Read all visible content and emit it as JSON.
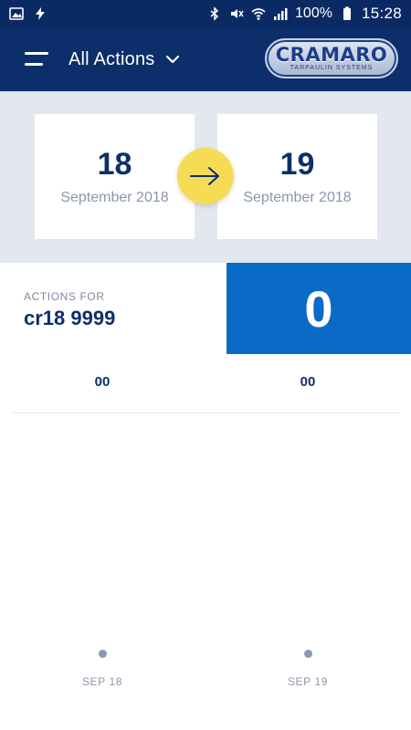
{
  "status_bar": {
    "battery_percent": "100%",
    "time": "15:28",
    "icons": [
      "image-icon",
      "flash-icon",
      "bluetooth-icon",
      "mute-icon",
      "wifi-icon",
      "signal-icon",
      "battery-icon"
    ]
  },
  "app_bar": {
    "title": "All Actions",
    "logo": {
      "main": "CRAMARO",
      "sub": "TARPAULIN SYSTEMS"
    }
  },
  "date_range": {
    "from": {
      "day": "18",
      "month": "September 2018"
    },
    "to": {
      "day": "19",
      "month": "September 2018"
    }
  },
  "summary": {
    "label": "ACTIONS FOR",
    "vehicle": "cr18 9999",
    "count": "0"
  },
  "chart": {
    "columns": [
      {
        "value": "00",
        "date": "SEP 18"
      },
      {
        "value": "00",
        "date": "SEP 19"
      }
    ]
  },
  "colors": {
    "header": "#0c2e6a",
    "accent_blue": "#0a6bc6",
    "swap_yellow": "#f6dc55",
    "panel_bg": "#e3e7ee"
  }
}
